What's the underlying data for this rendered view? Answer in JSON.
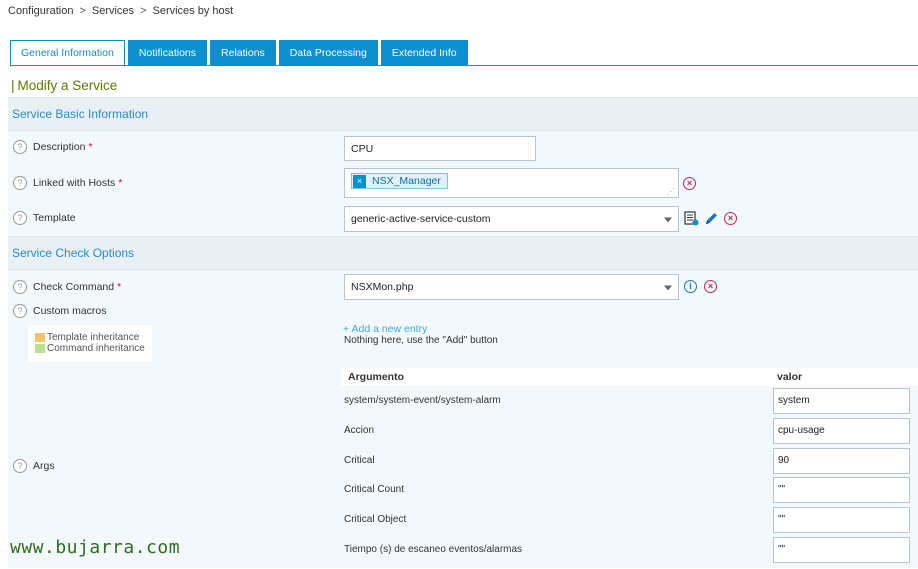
{
  "breadcrumb": [
    "Configuration",
    "Services",
    "Services by host"
  ],
  "tabs": [
    {
      "label": "General Information",
      "active": true
    },
    {
      "label": "Notifications",
      "active": false
    },
    {
      "label": "Relations",
      "active": false
    },
    {
      "label": "Data Processing",
      "active": false
    },
    {
      "label": "Extended Info",
      "active": false
    }
  ],
  "page_title": "Modify a Service",
  "sections": {
    "basic": "Service Basic Information",
    "check": "Service Check Options"
  },
  "fields": {
    "description": {
      "label": "Description",
      "value": "CPU"
    },
    "linked_hosts": {
      "label": "Linked with Hosts",
      "tag": "NSX_Manager",
      "tag_remove": "×"
    },
    "template": {
      "label": "Template",
      "value": "generic-active-service-custom"
    },
    "check_command": {
      "label": "Check Command",
      "value": "NSXMon.php"
    },
    "custom_macros": {
      "label": "Custom macros"
    },
    "args": {
      "label": "Args"
    }
  },
  "required_mark": "*",
  "legend": {
    "template": {
      "label": "Template inheritance",
      "color": "#f5c26b"
    },
    "command": {
      "label": "Command inheritance",
      "color": "#b7e38f"
    }
  },
  "macros": {
    "add_entry": "+ Add a new entry",
    "empty_text": "Nothing here, use the \"Add\" button"
  },
  "args_table": {
    "headers": [
      "Argumento",
      "valor"
    ],
    "rows": [
      {
        "name": "system/system-event/system-alarm",
        "value": "system"
      },
      {
        "name": "Accion",
        "value": "cpu-usage"
      },
      {
        "name": "Critical",
        "value": "90"
      },
      {
        "name": "Critical Count",
        "value": "\"\""
      },
      {
        "name": "Critical Object",
        "value": "\"\""
      },
      {
        "name": "Tiempo (s) de escaneo eventos/alarmas",
        "value": "\"\""
      }
    ]
  },
  "icons": {
    "help": "?",
    "delete": "×",
    "info": "i"
  },
  "watermark": "www.bujarra.com",
  "colors": {
    "accent": "#0c8fce",
    "title": "#5a7d00",
    "section": "#2c8ac5",
    "danger": "#c8284a"
  }
}
